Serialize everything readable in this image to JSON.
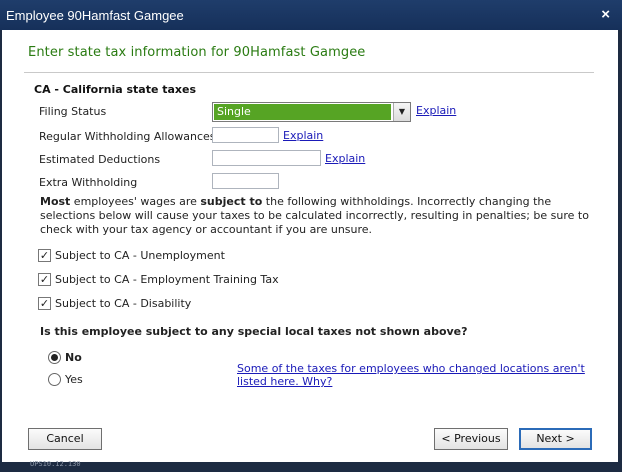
{
  "window": {
    "title": "Employee 90Hamfast Gamgee",
    "close_glyph": "×"
  },
  "heading": "Enter state tax information for 90Hamfast Gamgee",
  "section_title": "CA - California state taxes",
  "fields": {
    "filing_status": {
      "label": "Filing Status",
      "value": "Single",
      "link": "Explain"
    },
    "regular_withholding": {
      "label": "Regular Withholding Allowances",
      "value": "",
      "link": "Explain"
    },
    "estimated_deductions": {
      "label": "Estimated Deductions",
      "value": "",
      "link": "Explain"
    },
    "extra_withholding": {
      "label": "Extra Withholding",
      "value": ""
    }
  },
  "notice": {
    "bold1": "Most",
    "text1": " employees' wages are ",
    "bold2": "subject to",
    "text2": " the following withholdings.  Incorrectly changing the selections below will cause your taxes to be calculated incorrectly, resulting in penalties; be sure to check with your tax agency or accountant if you are unsure."
  },
  "checkboxes": [
    {
      "label": "Subject to CA - Unemployment",
      "checked": true
    },
    {
      "label": "Subject to CA - Employment Training Tax",
      "checked": true
    },
    {
      "label": "Subject to CA - Disability",
      "checked": true
    }
  ],
  "local_tax_question": "Is this employee subject to any special local taxes not shown above?",
  "radios": {
    "no": "No",
    "yes": "Yes",
    "selected": "no"
  },
  "help_link": {
    "line1": "Some of the taxes for employees who changed locations aren't",
    "line2": "listed here.  Why?"
  },
  "buttons": {
    "cancel": "Cancel",
    "previous": "< Previous",
    "next": "Next >"
  },
  "footer": "UPS10.12.130"
}
